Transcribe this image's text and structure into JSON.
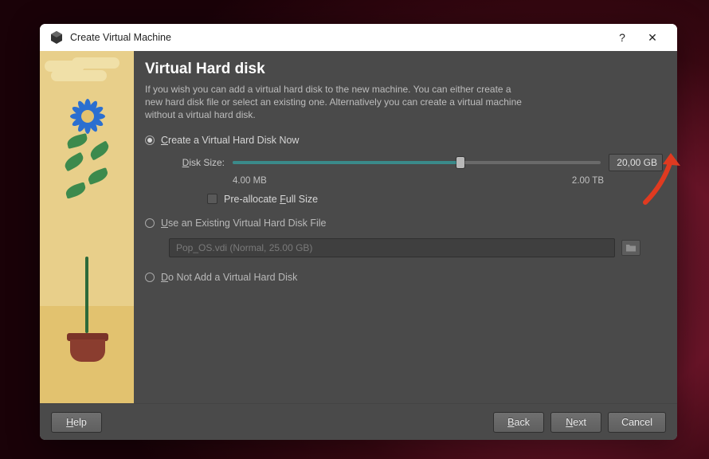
{
  "window": {
    "title": "Create Virtual Machine"
  },
  "page": {
    "heading": "Virtual Hard disk",
    "intro": "If you wish you can add a virtual hard disk to the new machine. You can either create a new hard disk file or select an existing one. Alternatively you can create a virtual machine without a virtual hard disk.",
    "options": {
      "create_now": "Create a Virtual Hard Disk Now",
      "use_existing": "Use an Existing Virtual Hard Disk File",
      "do_not_add": "Do Not Add a Virtual Hard Disk"
    },
    "disk_size_label": "Disk Size:",
    "disk_size_value": "20,00 GB",
    "disk_min": "4.00 MB",
    "disk_max": "2.00 TB",
    "preallocate": "Pre-allocate Full Size",
    "existing_file_display": "Pop_OS.vdi (Normal, 25.00 GB)"
  },
  "footer": {
    "help": "Help",
    "back": "Back",
    "next": "Next",
    "cancel": "Cancel"
  },
  "icons": {
    "help_glyph": "?",
    "close_glyph": "✕"
  }
}
